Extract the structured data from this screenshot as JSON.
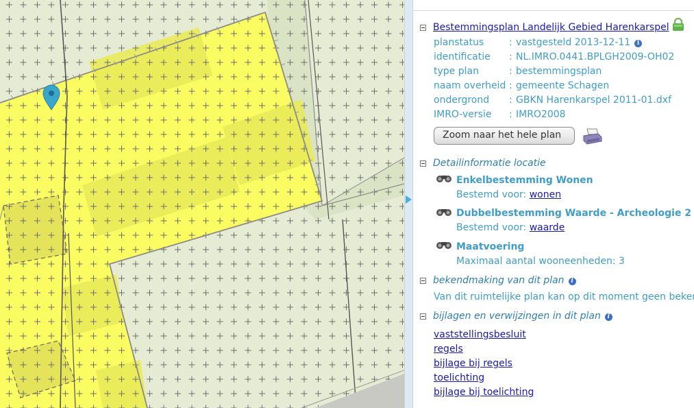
{
  "map": {
    "marker": "location-pin-icon"
  },
  "panel": {
    "plan_title": "Bestemmingsplan Landelijk Gebied Harenkarspel",
    "properties": [
      {
        "key": "planstatus",
        "value": "vastgesteld 2013-12-11",
        "info": true
      },
      {
        "key": "identificatie",
        "value": "NL.IMRO.0441.BPLGH2009-OH02"
      },
      {
        "key": "type plan",
        "value": "bestemmingsplan"
      },
      {
        "key": "naam overheid",
        "value": "gemeente Schagen"
      },
      {
        "key": "ondergrond",
        "value": "GBKN Harenkarspel 2011-01.dxf"
      },
      {
        "key": "IMRO-versie",
        "value": "IMRO2008"
      }
    ],
    "separator": ":",
    "zoom_button": "Zoom naar het hele plan",
    "detail_section": "Detailinformatie locatie",
    "details": [
      {
        "title": "Enkelbestemming Wonen",
        "prefix": "Bestemd voor: ",
        "link": "wonen"
      },
      {
        "title": "Dubbelbestemming Waarde - Archeologie 2",
        "prefix": "Bestemd voor: ",
        "link": "waarde"
      },
      {
        "title": "Maatvoering",
        "text": "Maximaal aantal wooneenheden: 3"
      }
    ],
    "bekendmaking_section": "bekendmaking van dit plan",
    "bekendmaking_text": "Van dit ruimtelijke plan kan op dit moment geen bekendmaking",
    "bijlagen_section": "bijlagen en verwijzingen in dit plan",
    "documents": [
      "vaststellingsbesluit",
      "regels",
      "bijlage bij regels",
      "toelichting",
      "bijlage bij toelichting"
    ]
  },
  "colors": {
    "plot_yellow": "#fbfb62",
    "meadow": "#e6ecd4",
    "accent": "#3f9dc8",
    "link": "#1a1aa8"
  }
}
